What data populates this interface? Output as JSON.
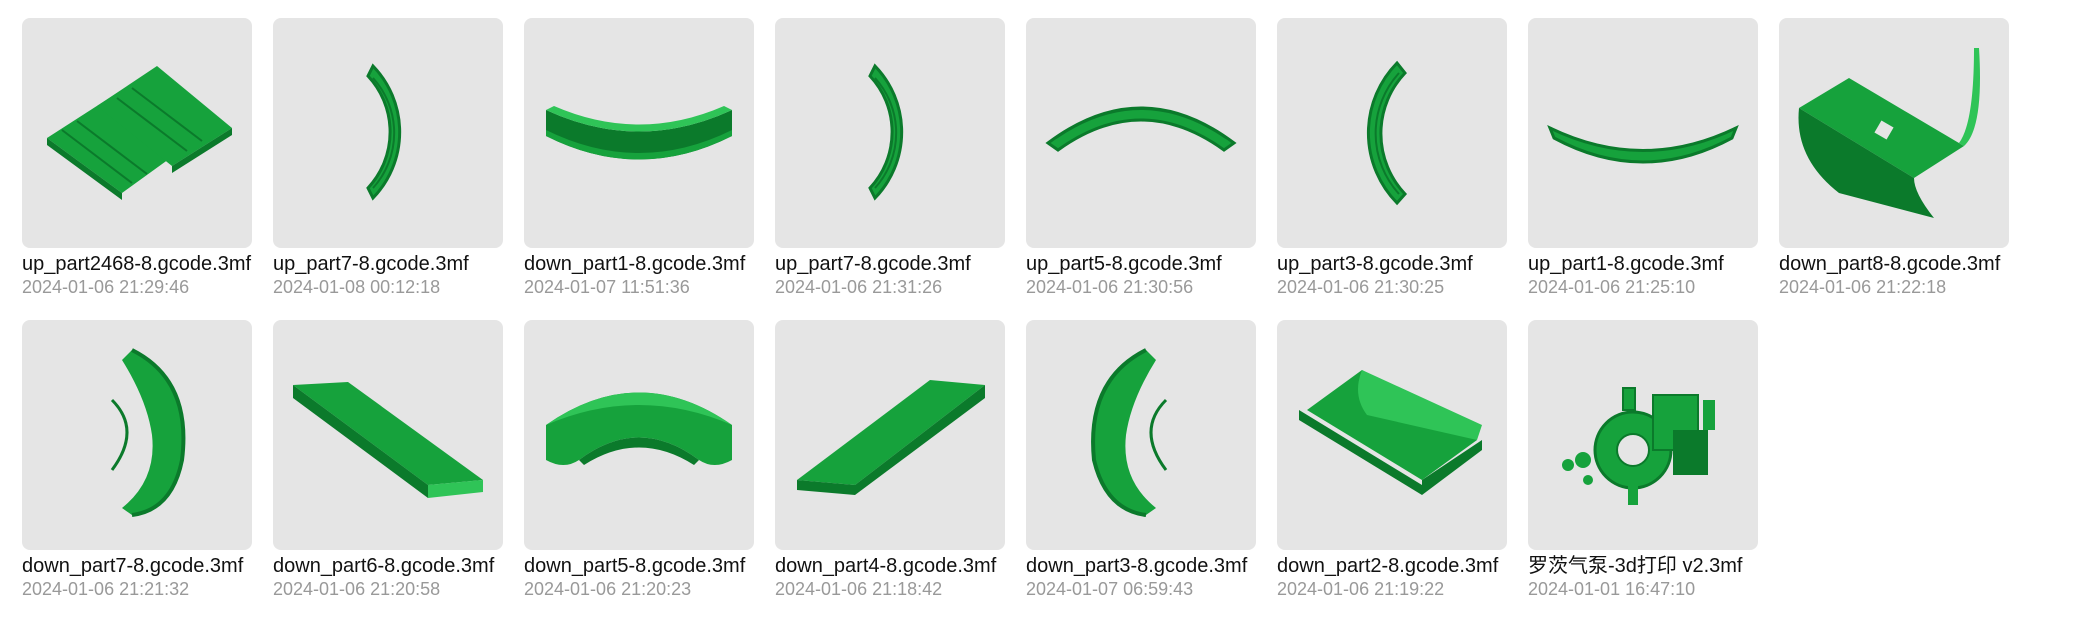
{
  "colors": {
    "part_green": "#16a23c",
    "part_green_dark": "#0b7a2b",
    "part_green_light": "#2fc457",
    "thumb_bg": "#e5e5e5",
    "date_text": "#999999"
  },
  "files": [
    {
      "name": "up_part2468-8.gcode.3mf",
      "date": "2024-01-06 21:29:46",
      "thumb": "two-flat-strips"
    },
    {
      "name": "up_part7-8.gcode.3mf",
      "date": "2024-01-08 00:12:18",
      "thumb": "arc-right"
    },
    {
      "name": "down_part1-8.gcode.3mf",
      "date": "2024-01-07 11:51:36",
      "thumb": "bowl-arc"
    },
    {
      "name": "up_part7-8.gcode.3mf",
      "date": "2024-01-06 21:31:26",
      "thumb": "arc-right"
    },
    {
      "name": "up_part5-8.gcode.3mf",
      "date": "2024-01-06 21:30:56",
      "thumb": "arc-top"
    },
    {
      "name": "up_part3-8.gcode.3mf",
      "date": "2024-01-06 21:30:25",
      "thumb": "arc-left"
    },
    {
      "name": "up_part1-8.gcode.3mf",
      "date": "2024-01-06 21:25:10",
      "thumb": "arc-bottom-thin"
    },
    {
      "name": "down_part8-8.gcode.3mf",
      "date": "2024-01-06 21:22:18",
      "thumb": "curved-tray-hole"
    },
    {
      "name": "down_part7-8.gcode.3mf",
      "date": "2024-01-06 21:21:32",
      "thumb": "c-channel-right"
    },
    {
      "name": "down_part6-8.gcode.3mf",
      "date": "2024-01-06 21:20:58",
      "thumb": "tray-diagonal-down"
    },
    {
      "name": "down_part5-8.gcode.3mf",
      "date": "2024-01-06 21:20:23",
      "thumb": "bowl-channel"
    },
    {
      "name": "down_part4-8.gcode.3mf",
      "date": "2024-01-06 21:18:42",
      "thumb": "tray-diagonal-up"
    },
    {
      "name": "down_part3-8.gcode.3mf",
      "date": "2024-01-07 06:59:43",
      "thumb": "c-channel-left"
    },
    {
      "name": "down_part2-8.gcode.3mf",
      "date": "2024-01-06 21:19:22",
      "thumb": "curved-tray"
    },
    {
      "name": "罗茨气泵-3d打印 v2.3mf",
      "date": "2024-01-01 16:47:10",
      "thumb": "pump-assembly"
    }
  ]
}
